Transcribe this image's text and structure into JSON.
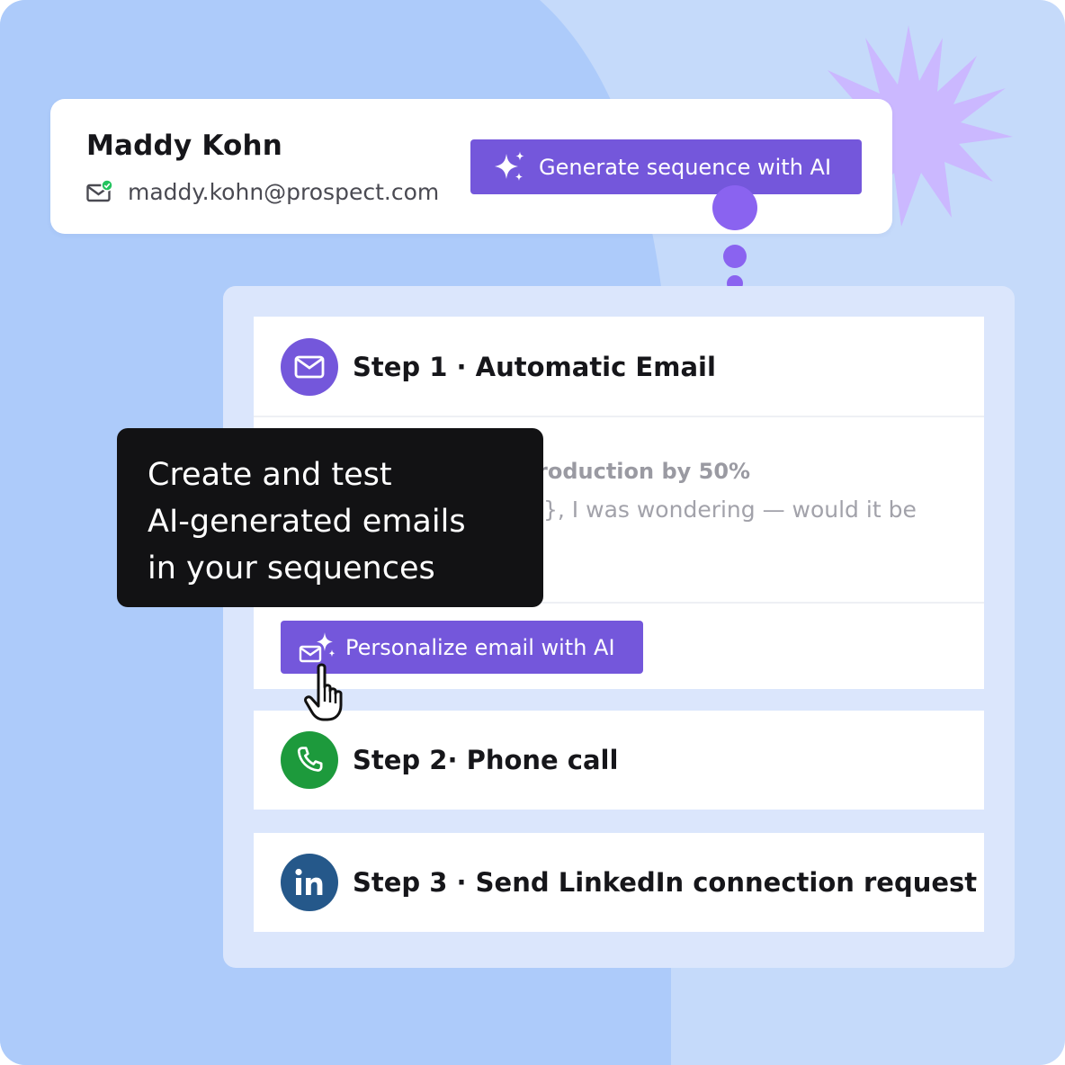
{
  "contact": {
    "name": "Maddy Kohn",
    "email": "maddy.kohn@prospect.com"
  },
  "actions": {
    "generate_label": "Generate sequence with AI",
    "personalize_label": "Personalize email with AI"
  },
  "tooltip": {
    "lines": [
      "Create and test",
      "AI-generated emails",
      "in your sequences"
    ]
  },
  "steps": [
    {
      "title": "Step 1 · Automatic Email",
      "icon": "mail-icon",
      "color": "#7457db",
      "subject": "roduction by 50%",
      "preview": "}, I was wondering — would it be"
    },
    {
      "title": "Step 2· Phone call",
      "icon": "phone-icon",
      "color": "#1d9a3c"
    },
    {
      "title": "Step 3 · Send LinkedIn connection request",
      "icon": "linkedin-icon",
      "color": "#25588a"
    }
  ],
  "colors": {
    "accent": "#7457db",
    "background": "#c5dafa",
    "blob": "#adcbfa",
    "panel": "#dbe6fc",
    "starburst": "#cbb8ff",
    "verified": "#22c35e"
  }
}
